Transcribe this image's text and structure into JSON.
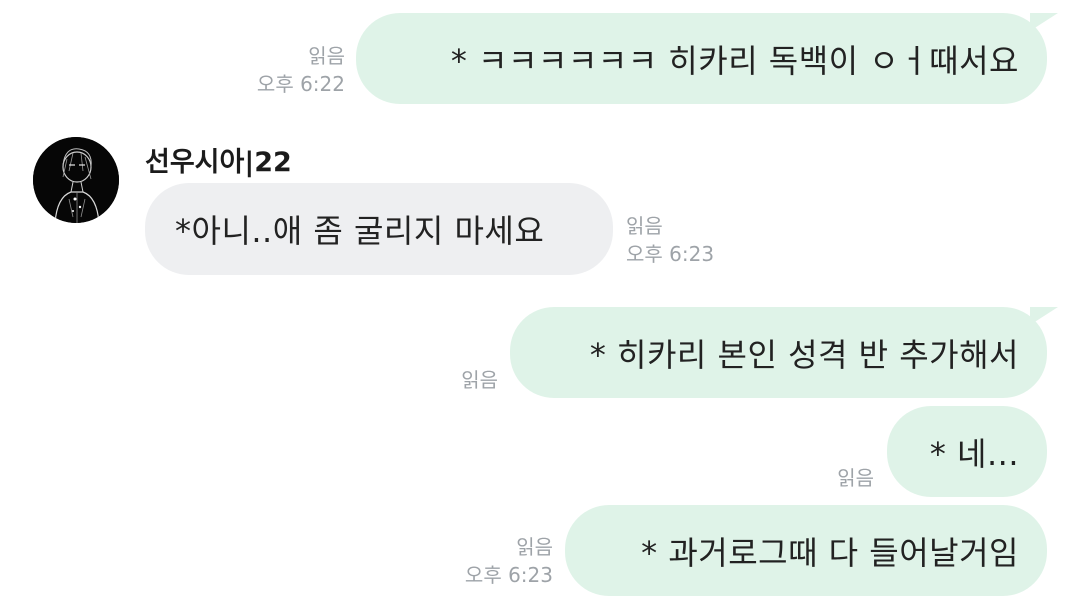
{
  "colors": {
    "outgoing_bubble": "#dff3e8",
    "incoming_bubble": "#eeeff1",
    "meta_text": "#9ea3a8",
    "message_text": "#222222"
  },
  "messages": [
    {
      "direction": "outgoing",
      "text": "* ㅋㅋㅋㅋㅋㅋ 히카리 독백이 ㅇㅓ때서요",
      "read_label": "읽음",
      "time": "오후 6:22"
    },
    {
      "direction": "incoming",
      "sender": "선우시아|22",
      "avatar_icon": "profile-avatar-icon",
      "text": "*아니..애 좀 굴리지 마세요",
      "read_label": "읽음",
      "time": "오후 6:23"
    },
    {
      "direction": "outgoing",
      "text": "* 히카리 본인 성격 반 추가해서",
      "read_label": "읽음"
    },
    {
      "direction": "outgoing",
      "text": "* 네...",
      "read_label": "읽음"
    },
    {
      "direction": "outgoing",
      "text": "* 과거로그때 다 들어날거임",
      "read_label": "읽음",
      "time": "오후 6:23"
    }
  ]
}
